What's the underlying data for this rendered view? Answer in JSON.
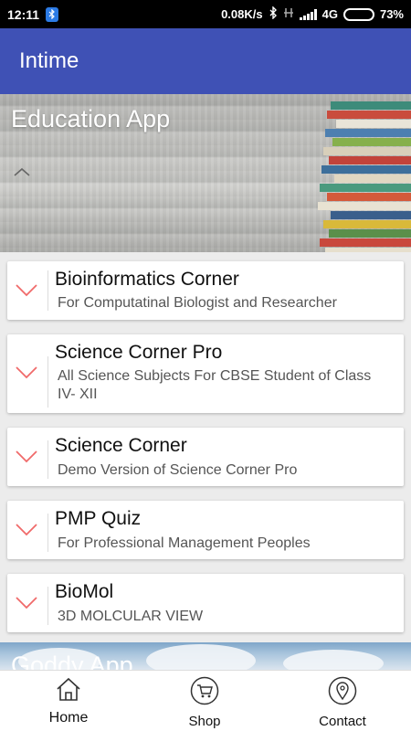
{
  "status_bar": {
    "time": "12:11",
    "speed": "0.08K/s",
    "network": "4G",
    "battery_percent": "73%",
    "battery_level": 0.73
  },
  "app_bar": {
    "title": "Intime"
  },
  "hero": {
    "title": "Education App"
  },
  "apps": [
    {
      "title": "Bioinformatics Corner",
      "subtitle": "For Computatinal Biologist and Researcher"
    },
    {
      "title": "Science Corner Pro",
      "subtitle": "All Science Subjects For CBSE Student of Class IV- XII"
    },
    {
      "title": "Science Corner",
      "subtitle": "Demo Version of Science Corner Pro"
    },
    {
      "title": "PMP Quiz",
      "subtitle": "For Professional Management Peoples"
    },
    {
      "title": "BioMol",
      "subtitle": "3D MOLCULAR VIEW"
    }
  ],
  "hero2": {
    "title": "Goddy App"
  },
  "bottom_nav": [
    {
      "label": "Home",
      "icon": "home-icon",
      "active": true
    },
    {
      "label": "Shop",
      "icon": "cart-icon",
      "active": false
    },
    {
      "label": "Contact",
      "icon": "location-pin-icon",
      "active": false
    }
  ],
  "colors": {
    "app_bar": "#3f51b5",
    "chevron_accent": "#f06a6a",
    "status_bar": "#000000"
  }
}
